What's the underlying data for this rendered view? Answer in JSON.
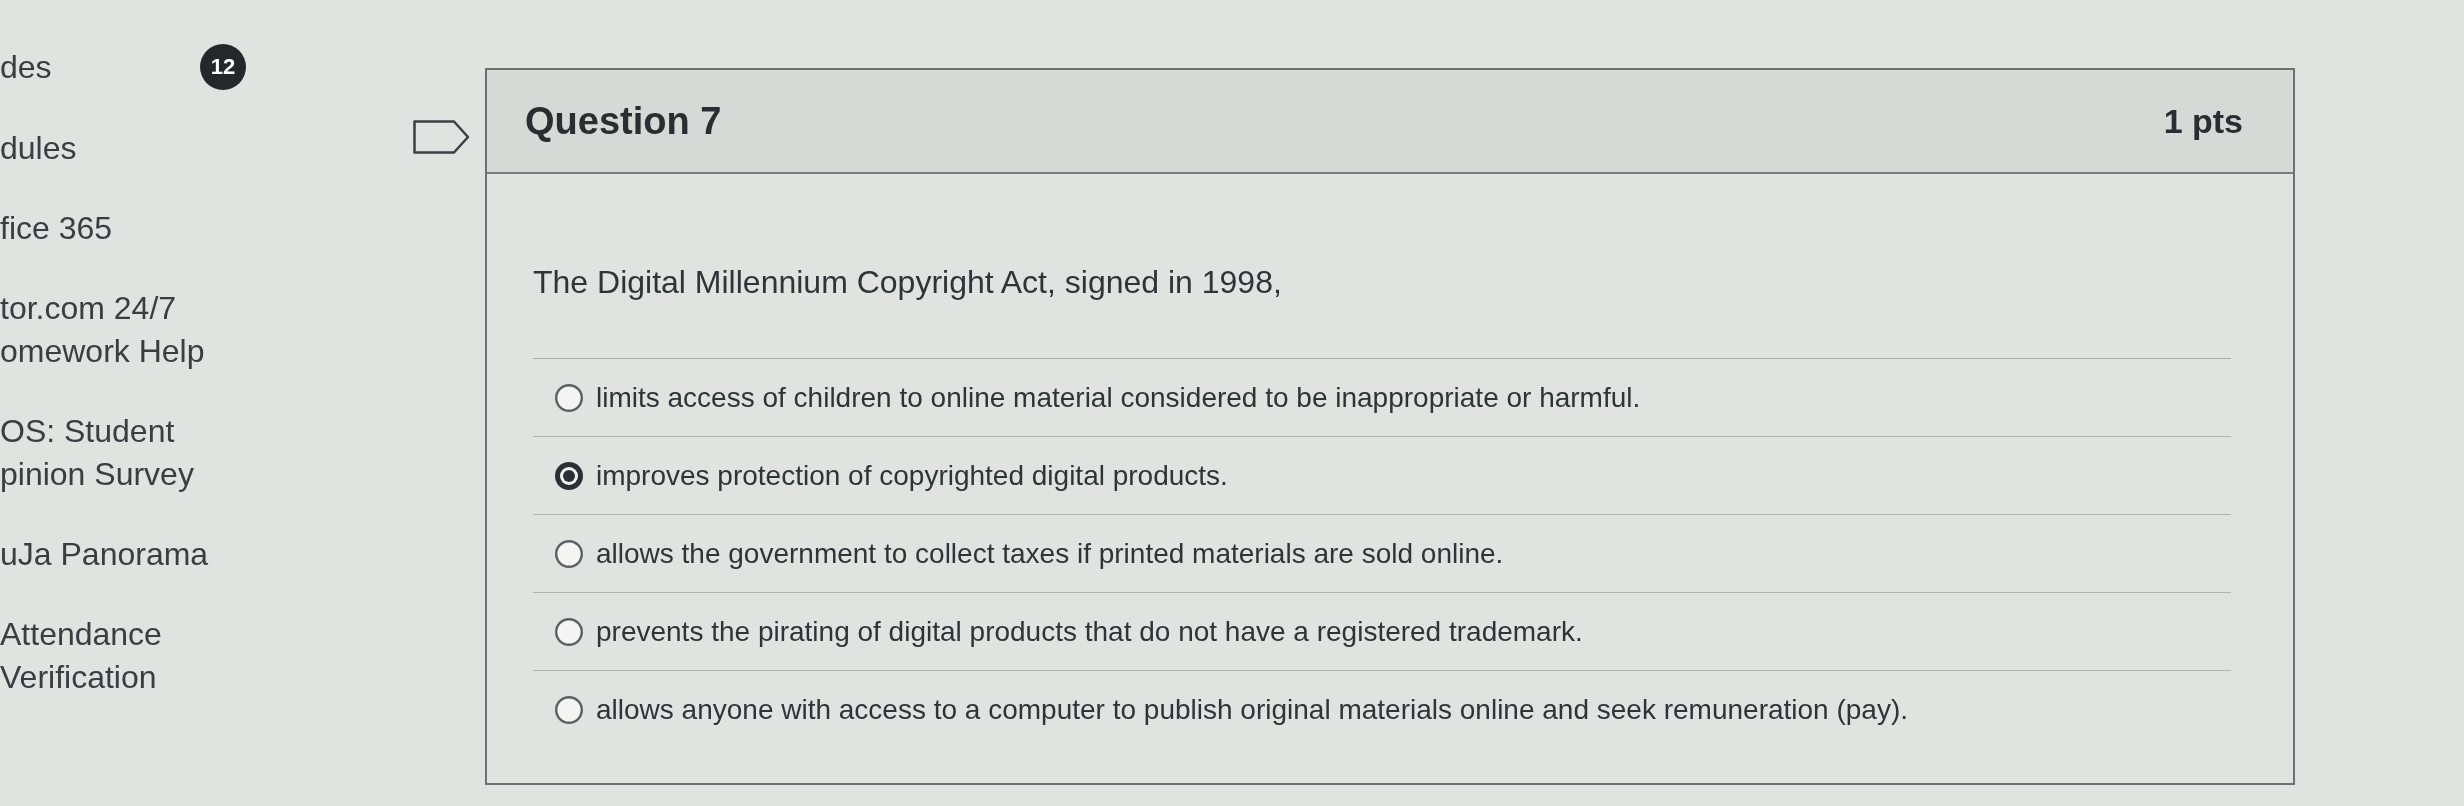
{
  "sidebar": {
    "items": [
      {
        "lines": [
          "des"
        ],
        "badge": "12"
      },
      {
        "lines": [
          "dules"
        ]
      },
      {
        "lines": [
          "fice 365"
        ]
      },
      {
        "lines": [
          "tor.com 24/7",
          "omework Help"
        ]
      },
      {
        "lines": [
          "OS: Student",
          "pinion Survey"
        ]
      },
      {
        "lines": [
          "uJa Panorama"
        ]
      },
      {
        "lines": [
          "Attendance",
          "Verification"
        ]
      }
    ]
  },
  "question": {
    "flagged": false,
    "title": "Question 7",
    "points": "1 pts",
    "text": "The Digital Millennium Copyright Act, signed in 1998,",
    "answers": [
      {
        "text": "limits access of children to online material considered to be inappropriate or harmful.",
        "selected": false
      },
      {
        "text": "improves protection of copyrighted digital products.",
        "selected": true
      },
      {
        "text": "allows the government to collect taxes if printed materials are sold online.",
        "selected": false
      },
      {
        "text": "prevents the pirating of digital products that do not have a registered trademark.",
        "selected": false
      },
      {
        "text": "allows anyone with access to a computer to publish original materials online and seek remuneration (pay).",
        "selected": false
      }
    ]
  }
}
